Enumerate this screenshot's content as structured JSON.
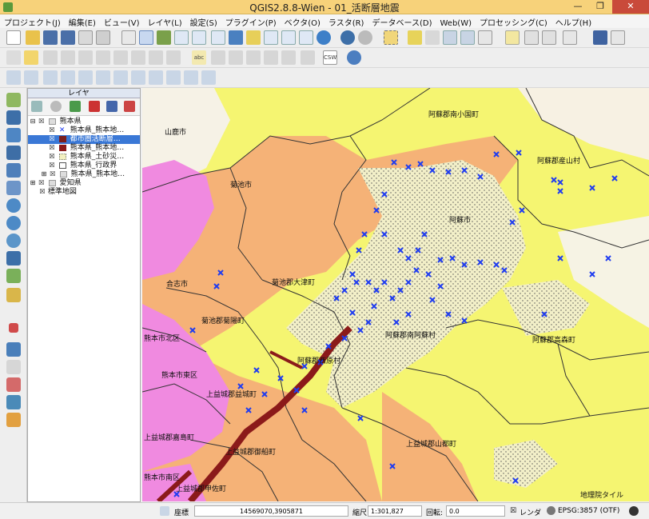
{
  "window": {
    "title": "QGIS2.8.8-Wien - 01_活断層地震",
    "minimize": "—",
    "maximize": "❐",
    "close": "✕"
  },
  "menu": [
    "プロジェクト(J)",
    "編集(E)",
    "ビュー(V)",
    "レイヤ(L)",
    "設定(S)",
    "プラグイン(P)",
    "ベクタ(O)",
    "ラスタ(R)",
    "データベース(D)",
    "Web(W)",
    "プロセッシング(C)",
    "ヘルプ(H)"
  ],
  "toolbar_extra": {
    "csw": "CSW",
    "abc": "abc"
  },
  "layers_panel": {
    "title": "レイヤ",
    "items": [
      {
        "label": "熊本県",
        "expander": "⊟",
        "checked": "☒",
        "group": true
      },
      {
        "label": "熊本県_熊本地…",
        "checked": "☒",
        "symbol": "cross"
      },
      {
        "label": "都市圏活断層…",
        "checked": "☒",
        "symbol": "darkred",
        "selected": true
      },
      {
        "label": "熊本県_熊本地…",
        "checked": "☒",
        "symbol": "darkred2"
      },
      {
        "label": "熊本県_土砂災…",
        "checked": "☒",
        "symbol": "dotted"
      },
      {
        "label": "熊本県_行政界",
        "checked": "☒",
        "symbol": "empty"
      },
      {
        "label": "熊本県_熊本地…",
        "checked": "☒",
        "symbol": "group",
        "expander": "⊞"
      },
      {
        "label": "愛知県",
        "expander": "⊞",
        "checked": "☒",
        "group": true
      },
      {
        "label": "標準地図",
        "checked": "☒",
        "symbol": "none"
      }
    ]
  },
  "map": {
    "labels": {
      "yamaga": "山鹿市",
      "minamioguni": "阿蘇郡南小国町",
      "ubuyama": "阿蘇郡産山村",
      "kikuchi": "菊池市",
      "aso": "阿蘇市",
      "koshi": "合志市",
      "ozu": "菊池郡大津町",
      "kikuyo": "菊池郡菊陽町",
      "minamiaso": "阿蘇郡南阿蘇村",
      "takamori": "阿蘇郡高森町",
      "kita": "熊本市北区",
      "nishihara": "阿蘇郡西原村",
      "higashi": "熊本市東区",
      "mashiki": "上益城郡益城町",
      "kashima": "上益城郡嘉島町",
      "mifune": "上益城郡御船町",
      "yamato": "上益城郡山都町",
      "minami": "熊本市南区",
      "kosa": "上益城郡甲佐町",
      "attribution": "地理院タイル"
    }
  },
  "status": {
    "coord_label": "座標",
    "coord_value": "14569070,3905871",
    "scale_label": "縮尺",
    "scale_value": "1:301,827",
    "rotation_label": "回転:",
    "rotation_value": "0.0",
    "render_label": "レンダ",
    "render_checked": "☒",
    "crs": "EPSG:3857 (OTF)"
  }
}
